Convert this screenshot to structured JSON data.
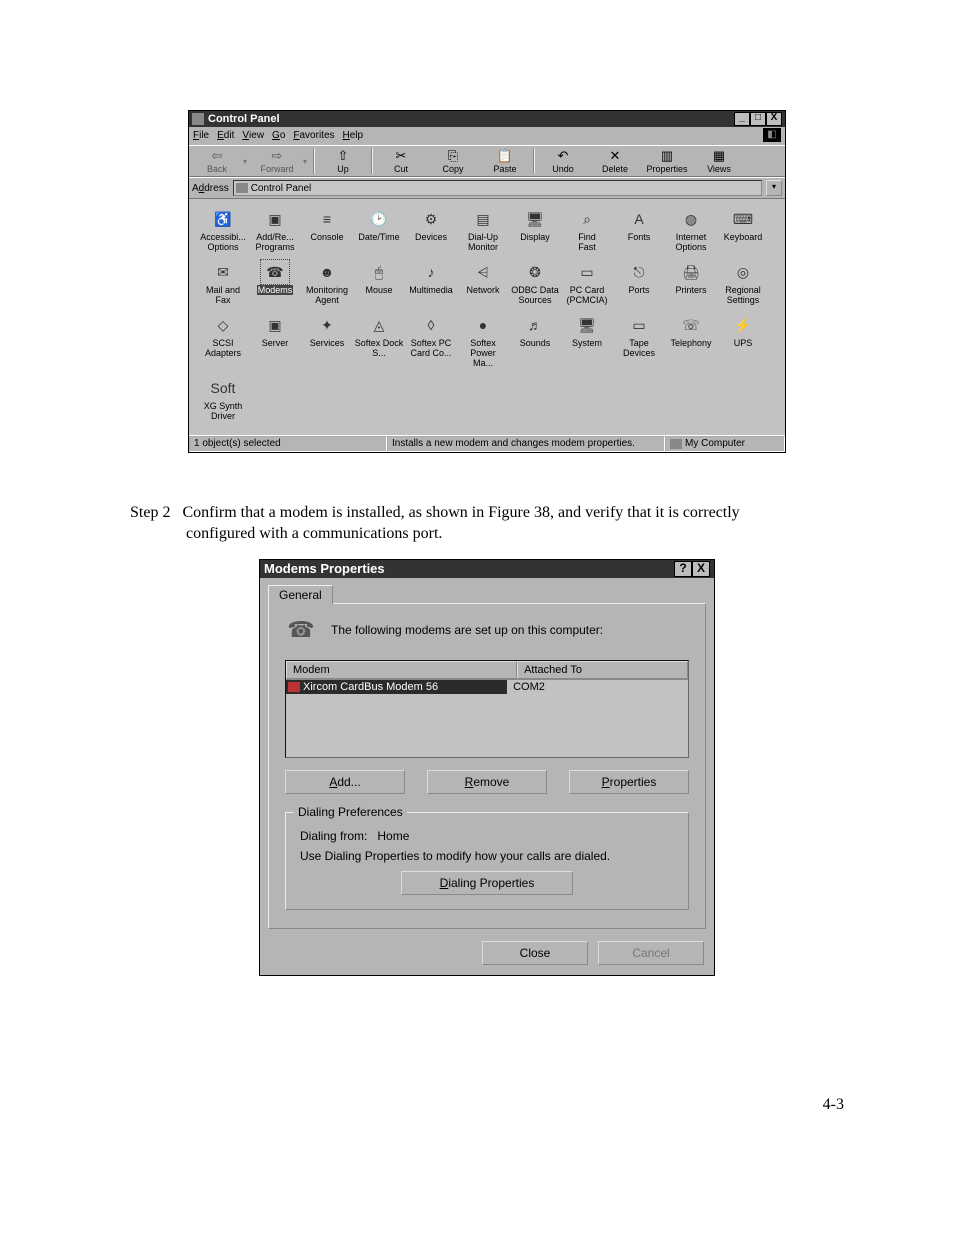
{
  "control_panel": {
    "title": "Control Panel",
    "menus": [
      "File",
      "Edit",
      "View",
      "Go",
      "Favorites",
      "Help"
    ],
    "toolbar": [
      {
        "label": "Back",
        "icon": "⇦",
        "enabled": false
      },
      {
        "label": "Forward",
        "icon": "⇨",
        "enabled": false
      },
      {
        "label": "Up",
        "icon": "⇧",
        "enabled": true
      },
      {
        "label": "Cut",
        "icon": "✂",
        "enabled": true
      },
      {
        "label": "Copy",
        "icon": "⎘",
        "enabled": true
      },
      {
        "label": "Paste",
        "icon": "📋",
        "enabled": true
      },
      {
        "label": "Undo",
        "icon": "↶",
        "enabled": true
      },
      {
        "label": "Delete",
        "icon": "✕",
        "enabled": true
      },
      {
        "label": "Properties",
        "icon": "▥",
        "enabled": true
      },
      {
        "label": "Views",
        "icon": "▦",
        "enabled": true
      }
    ],
    "address_label": "Address",
    "address_value": "Control Panel",
    "items": [
      {
        "label": "Accessibi... Options",
        "icon": "♿"
      },
      {
        "label": "Add/Re... Programs",
        "icon": "▣"
      },
      {
        "label": "Console",
        "icon": "≡"
      },
      {
        "label": "Date/Time",
        "icon": "🕑"
      },
      {
        "label": "Devices",
        "icon": "⚙"
      },
      {
        "label": "Dial-Up Monitor",
        "icon": "▤"
      },
      {
        "label": "Display",
        "icon": "🖥"
      },
      {
        "label": "Find Fast",
        "icon": "⌕"
      },
      {
        "label": "Fonts",
        "icon": "A"
      },
      {
        "label": "Internet Options",
        "icon": "◍"
      },
      {
        "label": "Keyboard",
        "icon": "⌨"
      },
      {
        "label": "Mail and Fax",
        "icon": "✉"
      },
      {
        "label": "Modems",
        "icon": "☎",
        "selected": true
      },
      {
        "label": "Monitoring Agent",
        "icon": "☻"
      },
      {
        "label": "Mouse",
        "icon": "🖱"
      },
      {
        "label": "Multimedia",
        "icon": "♪"
      },
      {
        "label": "Network",
        "icon": "⩤"
      },
      {
        "label": "ODBC Data Sources",
        "icon": "❂"
      },
      {
        "label": "PC Card (PCMCIA)",
        "icon": "▭"
      },
      {
        "label": "Ports",
        "icon": "⎋"
      },
      {
        "label": "Printers",
        "icon": "🖨"
      },
      {
        "label": "Regional Settings",
        "icon": "◎"
      },
      {
        "label": "SCSI Adapters",
        "icon": "◇"
      },
      {
        "label": "Server",
        "icon": "▣"
      },
      {
        "label": "Services",
        "icon": "✦"
      },
      {
        "label": "Softex Dock S...",
        "icon": "◬"
      },
      {
        "label": "Softex PC Card Co...",
        "icon": "◊"
      },
      {
        "label": "Softex Power Ma...",
        "icon": "●"
      },
      {
        "label": "Sounds",
        "icon": "♬"
      },
      {
        "label": "System",
        "icon": "🖥"
      },
      {
        "label": "Tape Devices",
        "icon": "▭"
      },
      {
        "label": "Telephony",
        "icon": "☏"
      },
      {
        "label": "UPS",
        "icon": "⚡"
      },
      {
        "label": "XG Synth Driver",
        "icon": "Soft"
      }
    ],
    "status": {
      "left": "1 object(s) selected",
      "middle": "Installs a new modem and changes modem properties.",
      "right": "My Computer"
    }
  },
  "step": {
    "label": "Step 2",
    "text_a": "Confirm that a modem is installed, as shown in Figure 38, and verify that it is correctly",
    "text_b": "configured with a communications port."
  },
  "modems": {
    "title": "Modems Properties",
    "tab": "General",
    "info": "The following modems are set up on this computer:",
    "columns": {
      "c1": "Modem",
      "c2": "Attached To"
    },
    "rows": [
      {
        "name": "Xircom CardBus Modem 56",
        "port": "COM2"
      }
    ],
    "buttons": {
      "add": "Add...",
      "remove": "Remove",
      "props": "Properties"
    },
    "group": {
      "legend": "Dialing Preferences",
      "from_label": "Dialing from:",
      "from_value": "Home",
      "desc": "Use Dialing Properties to modify how your calls are dialed.",
      "btn": "Dialing Properties"
    },
    "bottom": {
      "close": "Close",
      "cancel": "Cancel"
    }
  },
  "page_number": "4-3"
}
